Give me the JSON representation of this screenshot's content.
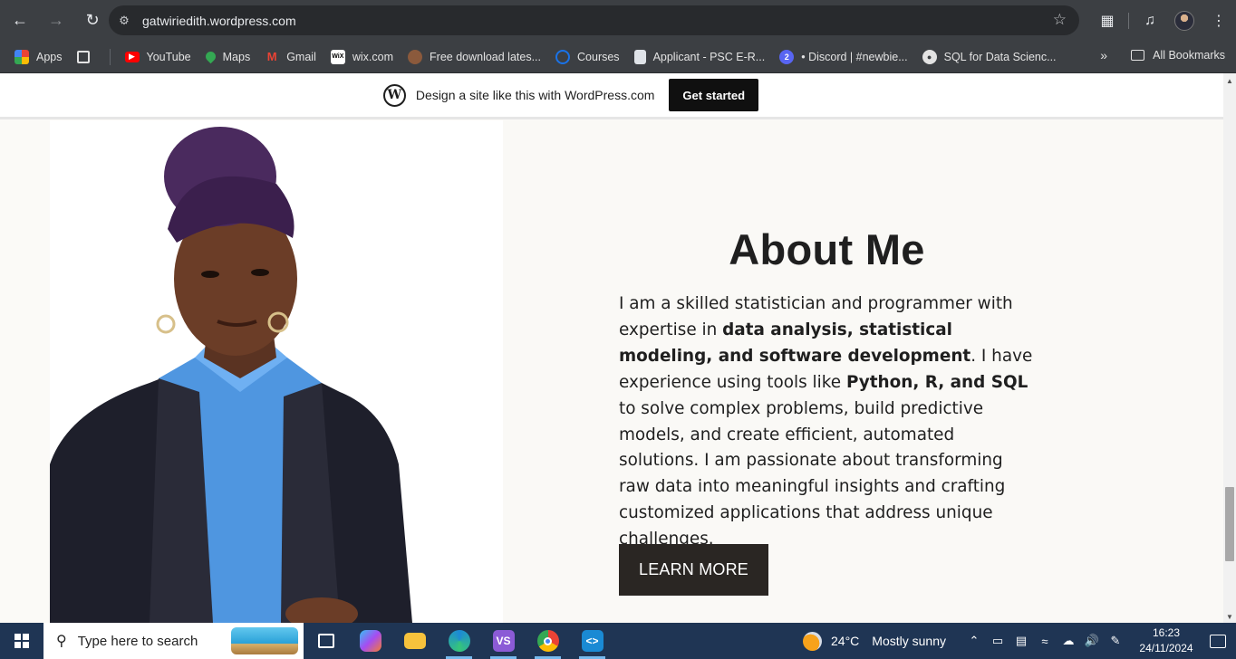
{
  "browser": {
    "url": "gatwiriedith.wordpress.com",
    "bookmarks": [
      {
        "label": "Apps",
        "icon": "apps-grid-icon",
        "color": "#4285f4"
      },
      {
        "label": "",
        "icon": "grid-icon",
        "color": "#3c3f43"
      },
      {
        "label": "YouTube",
        "icon": "youtube-icon",
        "color": "#ff0000"
      },
      {
        "label": "Maps",
        "icon": "maps-pin-icon",
        "color": "#34a853"
      },
      {
        "label": "Gmail",
        "icon": "gmail-icon",
        "color": "#ea4335"
      },
      {
        "label": "wix.com",
        "icon": "wix-icon",
        "color": "#ffffff"
      },
      {
        "label": "Free download lates...",
        "icon": "download-site-icon",
        "color": "#8b5a3c"
      },
      {
        "label": "Courses",
        "icon": "courses-ring-icon",
        "color": "#1a73e8"
      },
      {
        "label": "Applicant - PSC E-R...",
        "icon": "document-icon",
        "color": "#dfe3e8"
      },
      {
        "label": "• Discord | #newbie...",
        "icon": "discord-icon",
        "color": "#5865f2"
      },
      {
        "label": "SQL for Data Scienc...",
        "icon": "globe-icon",
        "color": "#e3e3e3"
      }
    ],
    "all_bookmarks": "All Bookmarks"
  },
  "wp_banner": {
    "text": "Design a site like this with WordPress.com",
    "button": "Get started"
  },
  "about": {
    "title": "About Me",
    "p1": "I am a skilled statistician and programmer with expertise in ",
    "b1": "data analysis, statistical modeling, and software development",
    "p2": ". I have experience using tools like ",
    "b2": "Python, R, and SQL",
    "p3": " to solve complex problems, build predictive models, and create efficient, automated solutions. I am passionate about transforming raw data into meaningful insights and crafting customized applications that address unique challenges.",
    "button": "LEARN MORE"
  },
  "taskbar": {
    "search_placeholder": "Type here to search",
    "weather_temp": "24°C",
    "weather_text": "Mostly sunny",
    "time": "16:23",
    "date": "24/11/2024"
  },
  "colors": {
    "chrome": "#3c3f43",
    "taskbar": "#1f3554",
    "button_dark": "#2a2623"
  }
}
